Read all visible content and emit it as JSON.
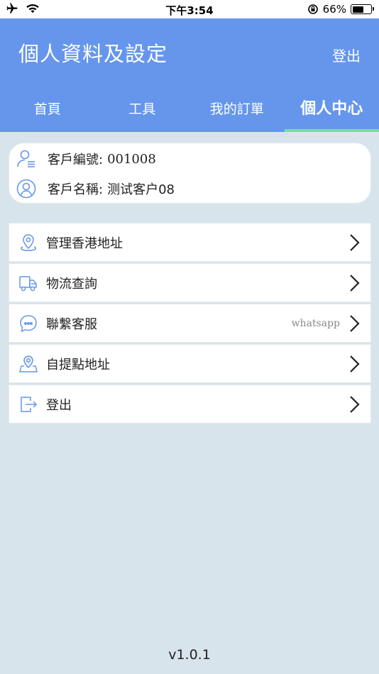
{
  "status_bar": {
    "time": "下午3:54",
    "battery_percent": "66%",
    "battery_level": 0.66
  },
  "header": {
    "title": "個人資料及設定",
    "logout_label": "登出"
  },
  "tabs": [
    {
      "label": "首頁",
      "active": false
    },
    {
      "label": "工具",
      "active": false
    },
    {
      "label": "我的訂單",
      "active": false
    },
    {
      "label": "個人中心",
      "active": true
    }
  ],
  "profile": {
    "customer_id_label": "客戶編號:",
    "customer_id_value": "001008",
    "customer_name_label": "客戶名稱:",
    "customer_name_value": "测试客户08"
  },
  "menu": [
    {
      "label": "管理香港地址",
      "icon": "location-pin-icon",
      "extra": ""
    },
    {
      "label": "物流查詢",
      "icon": "truck-icon",
      "extra": ""
    },
    {
      "label": "聯繫客服",
      "icon": "chat-bubble-icon",
      "extra": "whatsapp"
    },
    {
      "label": "自提點地址",
      "icon": "map-pin-icon",
      "extra": ""
    },
    {
      "label": "登出",
      "icon": "logout-icon",
      "extra": ""
    }
  ],
  "version": "v1.0.1",
  "colors": {
    "header_bg": "#6596ec",
    "tab_indicator": "#73e0a6",
    "page_bg": "#d8e4ec",
    "icon_blue": "#6596ec"
  }
}
